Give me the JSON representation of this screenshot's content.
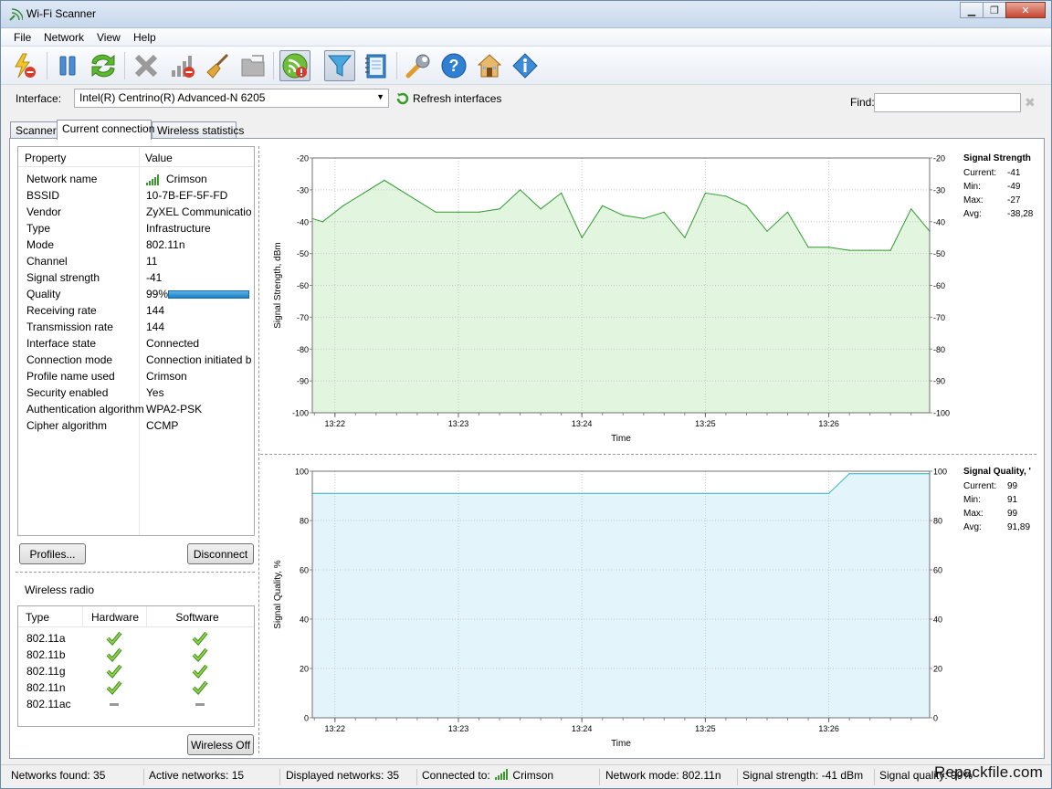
{
  "window": {
    "title": "Wi-Fi Scanner"
  },
  "menu": [
    "File",
    "Network",
    "View",
    "Help"
  ],
  "toolbar": {
    "icons": [
      "start-scan-icon",
      "pause-icon",
      "refresh-icon",
      "clear-icon",
      "signal-off-icon",
      "broom-icon",
      "folder-icon",
      "monitor-connection-icon",
      "filter-icon",
      "notebook-icon",
      "settings-wrench-icon",
      "help-icon",
      "home-icon",
      "info-icon"
    ]
  },
  "interface": {
    "label": "Interface:",
    "value": "Intel(R) Centrino(R) Advanced-N 6205",
    "refresh_label": "Refresh interfaces",
    "find_label": "Find:",
    "find_value": ""
  },
  "tabs": [
    "Scanner",
    "Current connection",
    "Wireless statistics"
  ],
  "properties": {
    "headers": [
      "Property",
      "Value"
    ],
    "rows": [
      {
        "k": "Network name",
        "v": "Crimson"
      },
      {
        "k": "BSSID",
        "v": "10-7B-EF-5F-FD"
      },
      {
        "k": "Vendor",
        "v": "ZyXEL Communicatio..."
      },
      {
        "k": "Type",
        "v": "Infrastructure"
      },
      {
        "k": "Mode",
        "v": "802.11n"
      },
      {
        "k": "Channel",
        "v": "11"
      },
      {
        "k": "Signal strength",
        "v": "-41"
      },
      {
        "k": "Quality",
        "v": "99%"
      },
      {
        "k": "Receiving rate",
        "v": "144"
      },
      {
        "k": "Transmission rate",
        "v": "144"
      },
      {
        "k": "Interface state",
        "v": "Connected"
      },
      {
        "k": "Connection mode",
        "v": "Connection initiated b..."
      },
      {
        "k": "Profile name used",
        "v": "Crimson"
      },
      {
        "k": "Security enabled",
        "v": "Yes"
      },
      {
        "k": "Authentication algorithm",
        "v": "WPA2-PSK"
      },
      {
        "k": "Cipher algorithm",
        "v": "CCMP"
      }
    ],
    "quality_fraction": 0.99
  },
  "buttons": {
    "profiles": "Profiles...",
    "disconnect": "Disconnect",
    "wireless_off": "Wireless Off"
  },
  "radio": {
    "title": "Wireless radio",
    "headers": [
      "Type",
      "Hardware",
      "Software"
    ],
    "rows": [
      {
        "t": "802.11a",
        "hw": "check",
        "sw": "check"
      },
      {
        "t": "802.11b",
        "hw": "check",
        "sw": "check"
      },
      {
        "t": "802.11g",
        "hw": "check",
        "sw": "check"
      },
      {
        "t": "802.11n",
        "hw": "check",
        "sw": "check"
      },
      {
        "t": "802.11ac",
        "hw": "dash",
        "sw": "dash"
      }
    ]
  },
  "chart_data": [
    {
      "type": "area",
      "ylabel": "Signal Strength, dBm",
      "xlabel": "Time",
      "ylim": [
        -100,
        -20
      ],
      "yticks": [
        -20,
        -30,
        -40,
        -50,
        -60,
        -70,
        -80,
        -90,
        -100
      ],
      "xlim": [
        "13:21:49",
        "13:26:49"
      ],
      "xticks": [
        "13:22",
        "13:23",
        "13:24",
        "13:25",
        "13:26"
      ],
      "x": [
        "13:21:49",
        "13:21:54",
        "13:22:04",
        "13:22:14",
        "13:22:24",
        "13:22:49",
        "13:23:00",
        "13:23:10",
        "13:23:20",
        "13:23:30",
        "13:23:40",
        "13:23:50",
        "13:24:00",
        "13:24:10",
        "13:24:20",
        "13:24:30",
        "13:24:40",
        "13:24:50",
        "13:25:00",
        "13:25:10",
        "13:25:20",
        "13:25:30",
        "13:25:40",
        "13:25:50",
        "13:26:00",
        "13:26:10",
        "13:26:20",
        "13:26:30",
        "13:26:40",
        "13:26:49"
      ],
      "values": [
        -39,
        -40,
        -35,
        -31,
        -27,
        -37,
        -37,
        -37,
        -36,
        -30,
        -36,
        -31,
        -45,
        -35,
        -38,
        -39,
        -37,
        -45,
        -31,
        -32,
        -35,
        -43,
        -37,
        -48,
        -48,
        -49,
        -49,
        -49,
        -36,
        -43
      ],
      "color": "#2f9a2f",
      "fill": "#e2f5df",
      "legend": {
        "title": "Signal  Strength",
        "rows": [
          [
            "Current:",
            "-41"
          ],
          [
            "Min:",
            "-49"
          ],
          [
            "Max:",
            "-27"
          ],
          [
            "Avg:",
            "-38,28"
          ]
        ]
      }
    },
    {
      "type": "area",
      "ylabel": "Signal Quality, %",
      "xlabel": "Time",
      "ylim": [
        0,
        100
      ],
      "yticks": [
        100,
        80,
        60,
        40,
        20,
        0
      ],
      "xlim": [
        "13:21:49",
        "13:26:49"
      ],
      "xticks": [
        "13:22",
        "13:23",
        "13:24",
        "13:25",
        "13:26"
      ],
      "x": [
        "13:21:49",
        "13:26:00",
        "13:26:10",
        "13:26:49"
      ],
      "values": [
        91,
        91,
        99,
        99
      ],
      "color": "#2bb0c0",
      "fill": "#e3f5fb",
      "legend": {
        "title": "Signal Quality, '",
        "rows": [
          [
            "Current:",
            "99"
          ],
          [
            "Min:",
            "91"
          ],
          [
            "Max:",
            "99"
          ],
          [
            "Avg:",
            "91,89"
          ]
        ]
      }
    }
  ],
  "status": {
    "networks_found": "Networks found: 35",
    "active_networks": "Active networks: 15",
    "displayed_networks": "Displayed networks: 35",
    "connected_to_label": "Connected to:",
    "connected_to": "Crimson",
    "network_mode": "Network mode: 802.11n",
    "signal_strength": "Signal strength: -41 dBm",
    "signal_quality": "Signal quality: 99%"
  },
  "watermark": "Repackfile.com"
}
